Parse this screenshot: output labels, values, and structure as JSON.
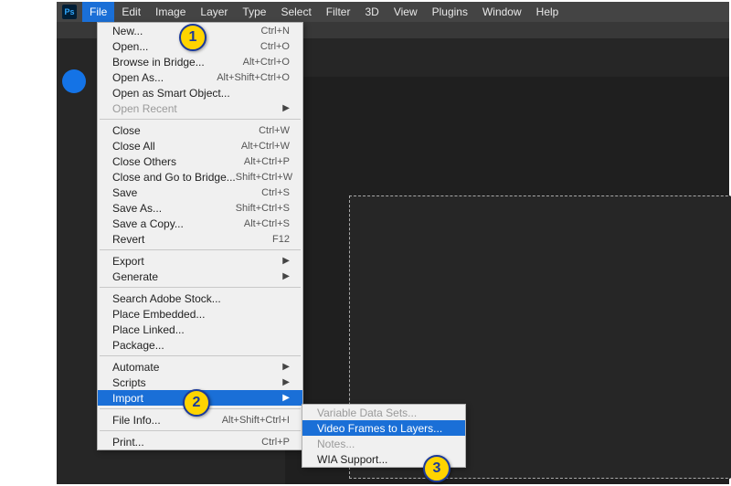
{
  "logo": "Ps",
  "menubar": [
    "File",
    "Edit",
    "Image",
    "Layer",
    "Type",
    "Select",
    "Filter",
    "3D",
    "View",
    "Plugins",
    "Window",
    "Help"
  ],
  "active_menu_index": 0,
  "file_menu": {
    "groups": [
      [
        {
          "label": "New...",
          "shortcut": "Ctrl+N"
        },
        {
          "label": "Open...",
          "shortcut": "Ctrl+O"
        },
        {
          "label": "Browse in Bridge...",
          "shortcut": "Alt+Ctrl+O"
        },
        {
          "label": "Open As...",
          "shortcut": "Alt+Shift+Ctrl+O"
        },
        {
          "label": "Open as Smart Object..."
        },
        {
          "label": "Open Recent",
          "submenu": true,
          "disabled": true
        }
      ],
      [
        {
          "label": "Close",
          "shortcut": "Ctrl+W"
        },
        {
          "label": "Close All",
          "shortcut": "Alt+Ctrl+W"
        },
        {
          "label": "Close Others",
          "shortcut": "Alt+Ctrl+P"
        },
        {
          "label": "Close and Go to Bridge...",
          "shortcut": "Shift+Ctrl+W"
        },
        {
          "label": "Save",
          "shortcut": "Ctrl+S"
        },
        {
          "label": "Save As...",
          "shortcut": "Shift+Ctrl+S"
        },
        {
          "label": "Save a Copy...",
          "shortcut": "Alt+Ctrl+S"
        },
        {
          "label": "Revert",
          "shortcut": "F12"
        }
      ],
      [
        {
          "label": "Export",
          "submenu": true
        },
        {
          "label": "Generate",
          "submenu": true
        }
      ],
      [
        {
          "label": "Search Adobe Stock..."
        },
        {
          "label": "Place Embedded..."
        },
        {
          "label": "Place Linked..."
        },
        {
          "label": "Package..."
        }
      ],
      [
        {
          "label": "Automate",
          "submenu": true
        },
        {
          "label": "Scripts",
          "submenu": true
        },
        {
          "label": "Import",
          "submenu": true,
          "highlight": true
        }
      ],
      [
        {
          "label": "File Info...",
          "shortcut": "Alt+Shift+Ctrl+I"
        }
      ],
      [
        {
          "label": "Print...",
          "shortcut": "Ctrl+P"
        }
      ]
    ]
  },
  "import_submenu": [
    {
      "label": "Variable Data Sets...",
      "disabled": true
    },
    {
      "label": "Video Frames to Layers...",
      "highlight": true
    },
    {
      "label": "Notes...",
      "disabled": true
    },
    {
      "label": "WIA Support..."
    }
  ],
  "badges": {
    "b1": "1",
    "b2": "2",
    "b3": "3"
  }
}
